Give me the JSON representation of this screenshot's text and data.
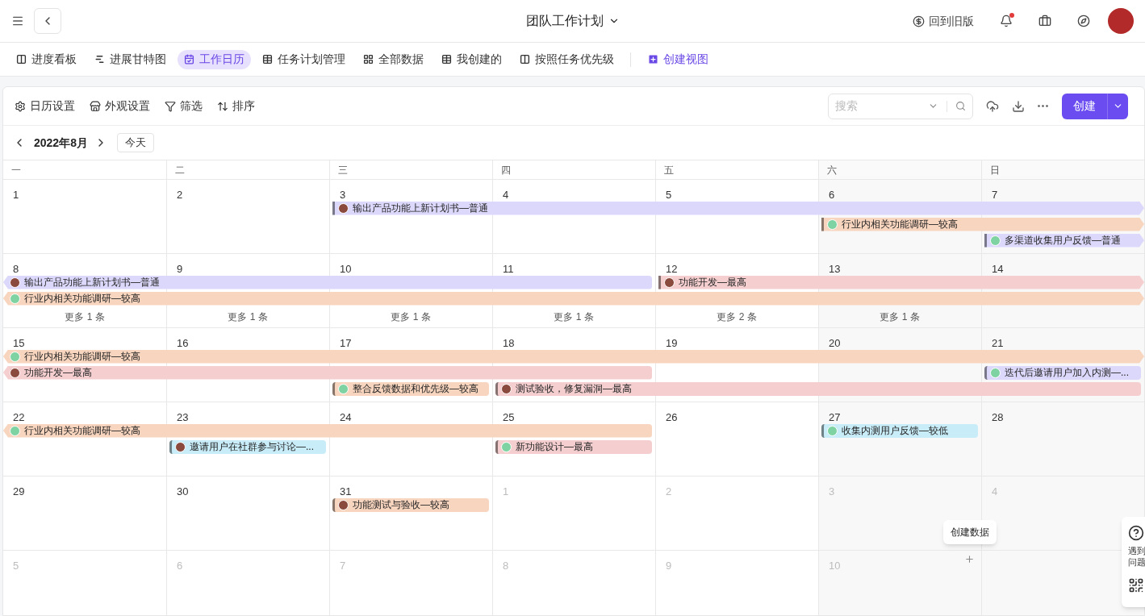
{
  "header": {
    "title": "团队工作计划",
    "old_version": "回到旧版",
    "notification_dot": true
  },
  "tabs": [
    {
      "label": "进度看板",
      "kind": "kanban",
      "selected": false
    },
    {
      "label": "进展甘特图",
      "kind": "gantt",
      "selected": false
    },
    {
      "label": "工作日历",
      "kind": "calendar",
      "selected": true
    },
    {
      "label": "任务计划管理",
      "kind": "table",
      "selected": false
    },
    {
      "label": "全部数据",
      "kind": "grid",
      "selected": false
    },
    {
      "label": "我创建的",
      "kind": "table",
      "selected": false
    },
    {
      "label": "按照任务优先级",
      "kind": "kanban",
      "selected": false
    }
  ],
  "create_view": "创建视图",
  "toolbar": {
    "items": [
      {
        "label": "日历设置",
        "kind": "settings"
      },
      {
        "label": "外观设置",
        "kind": "store"
      },
      {
        "label": "筛选",
        "kind": "filter"
      },
      {
        "label": "排序",
        "kind": "sort"
      }
    ],
    "search_placeholder": "搜索",
    "create_button": "创建"
  },
  "calendar": {
    "month": "2022年8月",
    "today_button": "今天",
    "weekdays": [
      "一",
      "二",
      "三",
      "四",
      "五",
      "六",
      "日"
    ],
    "weeks": [
      {
        "days": [
          {
            "label": "1",
            "in_month": true
          },
          {
            "label": "2",
            "in_month": true
          },
          {
            "label": "3",
            "in_month": true
          },
          {
            "label": "4",
            "in_month": true
          },
          {
            "label": "5",
            "in_month": true
          },
          {
            "label": "6",
            "in_month": true
          },
          {
            "label": "7",
            "in_month": true
          }
        ],
        "lanes": [
          [
            {
              "kind": "empty"
            },
            {
              "kind": "empty"
            },
            {
              "kind": "event",
              "title": "输出产品功能上新计划书—普通",
              "color": "#dcd8fb",
              "avatar": {
                "kind": "photo"
              },
              "continues_left": false,
              "continues_right": true
            },
            {
              "kind": "continued"
            },
            {
              "kind": "continued"
            },
            {
              "kind": "continued"
            },
            {
              "kind": "continued"
            }
          ],
          [
            {
              "kind": "empty"
            },
            {
              "kind": "empty"
            },
            {
              "kind": "empty"
            },
            {
              "kind": "empty"
            },
            {
              "kind": "empty"
            },
            {
              "kind": "event",
              "title": "行业内相关功能调研—较高",
              "color": "#f8d5bf",
              "avatar": {
                "kind": "initial"
              },
              "continues_left": false,
              "continues_right": true
            },
            {
              "kind": "continued"
            }
          ],
          [
            {
              "kind": "empty"
            },
            {
              "kind": "empty"
            },
            {
              "kind": "empty"
            },
            {
              "kind": "empty"
            },
            {
              "kind": "empty"
            },
            {
              "kind": "empty"
            },
            {
              "kind": "event",
              "title": "多渠道收集用户反馈—普通",
              "color": "#dcd8fb",
              "avatar": {
                "kind": "initial"
              },
              "continues_left": false,
              "continues_right": true
            }
          ]
        ]
      },
      {
        "days": [
          {
            "label": "8",
            "in_month": true
          },
          {
            "label": "9",
            "in_month": true
          },
          {
            "label": "10",
            "in_month": true
          },
          {
            "label": "11",
            "in_month": true
          },
          {
            "label": "12",
            "in_month": true
          },
          {
            "label": "13",
            "in_month": true
          },
          {
            "label": "14",
            "in_month": true
          }
        ],
        "lanes": [
          [
            {
              "kind": "event",
              "title": "输出产品功能上新计划书—普通",
              "color": "#dcd8fb",
              "avatar": {
                "kind": "photo"
              },
              "continues_left": true,
              "continues_right": false
            },
            {
              "kind": "continued"
            },
            {
              "kind": "continued"
            },
            {
              "kind": "continued"
            },
            {
              "kind": "event",
              "title": "功能开发—最高",
              "color": "#f5cfd0",
              "avatar": {
                "kind": "photo"
              },
              "continues_left": false,
              "continues_right": true
            },
            {
              "kind": "continued"
            },
            {
              "kind": "continued"
            }
          ],
          [
            {
              "kind": "event",
              "title": "行业内相关功能调研—较高",
              "color": "#f8d5bf",
              "avatar": {
                "kind": "initial"
              },
              "continues_left": true,
              "continues_right": true
            },
            {
              "kind": "continued"
            },
            {
              "kind": "continued"
            },
            {
              "kind": "continued"
            },
            {
              "kind": "continued"
            },
            {
              "kind": "continued"
            },
            {
              "kind": "continued"
            }
          ]
        ],
        "more": [
          "更多 1 条",
          "更多 1 条",
          "更多 1 条",
          "更多 1 条",
          "更多 2 条",
          "更多 1 条"
        ]
      },
      {
        "days": [
          {
            "label": "15",
            "in_month": true
          },
          {
            "label": "16",
            "in_month": true
          },
          {
            "label": "17",
            "in_month": true
          },
          {
            "label": "18",
            "in_month": true
          },
          {
            "label": "19",
            "in_month": true
          },
          {
            "label": "20",
            "in_month": true
          },
          {
            "label": "21",
            "in_month": true
          }
        ],
        "lanes": [
          [
            {
              "kind": "event",
              "title": "行业内相关功能调研—较高",
              "color": "#f8d5bf",
              "avatar": {
                "kind": "initial"
              },
              "continues_left": true,
              "continues_right": true
            },
            {
              "kind": "continued"
            },
            {
              "kind": "continued"
            },
            {
              "kind": "continued"
            },
            {
              "kind": "continued"
            },
            {
              "kind": "continued"
            },
            {
              "kind": "continued"
            }
          ],
          [
            {
              "kind": "event",
              "title": "功能开发—最高",
              "color": "#f5cfd0",
              "avatar": {
                "kind": "photo"
              },
              "continues_left": true,
              "continues_right": false
            },
            {
              "kind": "continued"
            },
            {
              "kind": "continued"
            },
            {
              "kind": "continued"
            },
            {
              "kind": "empty"
            },
            {
              "kind": "empty"
            },
            {
              "kind": "event",
              "title": "迭代后邀请用户加入内测—...",
              "color": "#dcd8fb",
              "avatar": {
                "kind": "initial"
              },
              "continues_left": false,
              "continues_right": false
            }
          ],
          [
            {
              "kind": "empty"
            },
            {
              "kind": "empty"
            },
            {
              "kind": "event",
              "title": "整合反馈数据和优先级—较高",
              "color": "#f8d5bf",
              "avatar": {
                "kind": "initial"
              },
              "continues_left": false,
              "continues_right": false
            },
            {
              "kind": "event",
              "title": "测试验收，修复漏洞—最高",
              "color": "#f5cfd0",
              "avatar": {
                "kind": "photo"
              },
              "continues_left": false,
              "continues_right": false
            },
            {
              "kind": "continued"
            },
            {
              "kind": "continued"
            },
            {
              "kind": "continued"
            }
          ]
        ]
      },
      {
        "days": [
          {
            "label": "22",
            "in_month": true
          },
          {
            "label": "23",
            "in_month": true
          },
          {
            "label": "24",
            "in_month": true
          },
          {
            "label": "25",
            "in_month": true
          },
          {
            "label": "26",
            "in_month": true
          },
          {
            "label": "27",
            "in_month": true
          },
          {
            "label": "28",
            "in_month": true
          }
        ],
        "lanes": [
          [
            {
              "kind": "event",
              "title": "行业内相关功能调研—较高",
              "color": "#f8d5bf",
              "avatar": {
                "kind": "initial"
              },
              "continues_left": true,
              "continues_right": false
            },
            {
              "kind": "continued"
            },
            {
              "kind": "continued"
            },
            {
              "kind": "continued"
            },
            {
              "kind": "empty"
            },
            {
              "kind": "event",
              "title": "收集内测用户反馈—较低",
              "color": "#c8ecf8",
              "avatar": {
                "kind": "initial"
              },
              "continues_left": false,
              "continues_right": false
            },
            {
              "kind": "empty"
            }
          ],
          [
            {
              "kind": "empty"
            },
            {
              "kind": "event",
              "title": "邀请用户在社群参与讨论—...",
              "color": "#c8ecf8",
              "avatar": {
                "kind": "photo"
              },
              "continues_left": false,
              "continues_right": false
            },
            {
              "kind": "empty"
            },
            {
              "kind": "event",
              "title": "新功能设计—最高",
              "color": "#f5cfd0",
              "avatar": {
                "kind": "initial"
              },
              "continues_left": false,
              "continues_right": false
            },
            {
              "kind": "empty"
            },
            {
              "kind": "empty"
            },
            {
              "kind": "empty"
            }
          ]
        ]
      },
      {
        "days": [
          {
            "label": "29",
            "in_month": true
          },
          {
            "label": "30",
            "in_month": true
          },
          {
            "label": "31",
            "in_month": true
          },
          {
            "label": "1",
            "in_month": false
          },
          {
            "label": "2",
            "in_month": false
          },
          {
            "label": "3",
            "in_month": false
          },
          {
            "label": "4",
            "in_month": false
          }
        ],
        "lanes": [
          [
            {
              "kind": "empty"
            },
            {
              "kind": "empty"
            },
            {
              "kind": "event",
              "title": "功能测试与验收—较高",
              "color": "#f8d5bf",
              "avatar": {
                "kind": "photo"
              },
              "continues_left": false,
              "continues_right": false
            },
            {
              "kind": "empty"
            },
            {
              "kind": "empty"
            },
            {
              "kind": "empty"
            },
            {
              "kind": "empty"
            }
          ]
        ]
      },
      {
        "days": [
          {
            "label": "5",
            "in_month": false
          },
          {
            "label": "6",
            "in_month": false
          },
          {
            "label": "7",
            "in_month": false
          },
          {
            "label": "8",
            "in_month": false
          },
          {
            "label": "9",
            "in_month": false
          },
          {
            "label": "10",
            "in_month": false
          }
        ]
      }
    ]
  },
  "tooltip": "创建数据",
  "help": {
    "lines": [
      "遇到",
      "问题"
    ]
  }
}
